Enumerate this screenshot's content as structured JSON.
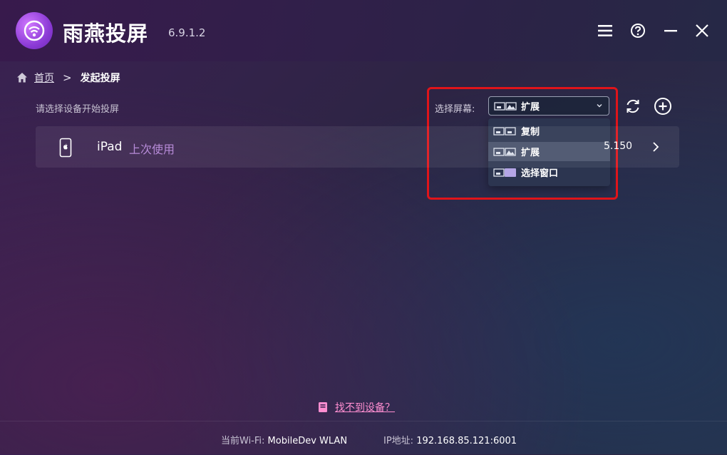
{
  "app": {
    "name": "雨燕投屏",
    "version": "6.9.1.2"
  },
  "window_controls": [
    "menu-icon",
    "help-icon",
    "minimize-icon",
    "close-icon"
  ],
  "breadcrumb": {
    "home": "首页",
    "separator": ">",
    "current": "发起投屏"
  },
  "hint": "请选择设备开始投屏",
  "screen_select": {
    "label": "选择屏幕:",
    "value": "扩展",
    "options": [
      {
        "label": "复制",
        "icon": "duplicate-screen-icon",
        "selected": false
      },
      {
        "label": "扩展",
        "icon": "extend-screen-icon",
        "selected": true
      },
      {
        "label": "选择窗口",
        "icon": "select-window-icon",
        "selected": false
      }
    ]
  },
  "toolbar": {
    "refresh_icon": "refresh-icon",
    "add_icon": "add-icon"
  },
  "devices": [
    {
      "name": "iPad",
      "tag": "上次使用",
      "ip_partial": "5.150"
    }
  ],
  "help_link": "找不到设备？",
  "footer": {
    "wifi_label": "当前Wi-Fi:",
    "wifi_value": "MobileDev WLAN",
    "ip_label": "IP地址:",
    "ip_value": "192.168.85.121:6001"
  },
  "colors": {
    "accent_pink": "#ff8ed1",
    "tag_purple": "#b78bd8",
    "highlight_red": "#e0141a"
  }
}
